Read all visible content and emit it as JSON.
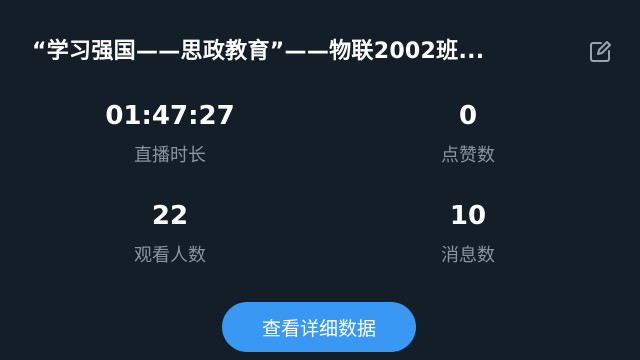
{
  "header": {
    "title": "“学习强国——思政教育”——物联2002班..."
  },
  "stats": [
    {
      "value": "01:47:27",
      "label": "直播时长"
    },
    {
      "value": "0",
      "label": "点赞数"
    },
    {
      "value": "22",
      "label": "观看人数"
    },
    {
      "value": "10",
      "label": "消息数"
    }
  ],
  "actions": {
    "detail_label": "查看详细数据"
  },
  "icons": {
    "edit": "edit-icon"
  },
  "colors": {
    "background": "#141e28",
    "accent": "#3a98f5",
    "muted_text": "#8a939d"
  }
}
